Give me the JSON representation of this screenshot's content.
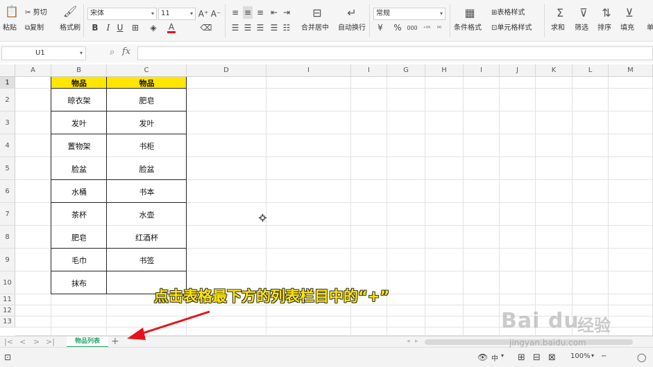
{
  "ribbon": {
    "paste_label": "粘贴",
    "cut_label": "剪切",
    "copy_label": "复制",
    "format_painter_label": "格式刷",
    "font_name": "宋体",
    "font_size": "11",
    "bold": "B",
    "italic": "I",
    "underline": "U",
    "font_color_glyph": "A",
    "increase_font": "A⁺",
    "decrease_font": "A⁻",
    "merge_label": "合并居中",
    "wrap_label": "自动换行",
    "number_format": "常规",
    "currency_glyph": "¥",
    "percent_glyph": "%",
    "thousands_glyph": "000",
    "inc_decimal_glyph": "⁺⁰⁰",
    "dec_decimal_glyph": "⁰⁰",
    "cond_format_label": "条件格式",
    "table_style_label": "表格样式",
    "cell_style_label": "单元格样式",
    "sum_label": "求和",
    "filter_label": "筛选",
    "sort_label": "排序",
    "fill_label": "填充",
    "more_label": "单"
  },
  "formula_bar": {
    "name_box": "U1",
    "fx_label": "fx",
    "formula": ""
  },
  "columns": [
    "A",
    "B",
    "C",
    "D",
    "I",
    "I",
    "G",
    "H",
    "I",
    "J",
    "K",
    "L",
    "M"
  ],
  "rows": [
    "1",
    "2",
    "3",
    "4",
    "5",
    "6",
    "7",
    "8",
    "9",
    "10",
    "11",
    "12",
    "13"
  ],
  "table": {
    "header_b": "物品",
    "header_c": "物品",
    "col_b": [
      "晾衣架",
      "发叶",
      "置物架",
      "脸盆",
      "水桶",
      "茶杯",
      "肥皂",
      "毛巾",
      "抹布"
    ],
    "col_c": [
      "肥皂",
      "发叶",
      "书柜",
      "脸盆",
      "书本",
      "水壶",
      "红酒杯",
      "书签",
      ""
    ]
  },
  "sheet_tabs": {
    "active": "物品列表",
    "add": "+"
  },
  "status_bar": {
    "input_mode": "中",
    "zoom": "100%",
    "zoom_minus": "−",
    "zoom_plus": "+"
  },
  "annotation": "点击表格最下方的列表栏目中的“+”",
  "watermark": {
    "logo": "Bai du",
    "experience": "经验",
    "url": "jingyan.baidu.com"
  },
  "colors": {
    "header_fill": "#ffe600",
    "annotation": "#ffe600",
    "arrow": "#e5131b",
    "sheet_tab_accent": "#2aa56a"
  }
}
